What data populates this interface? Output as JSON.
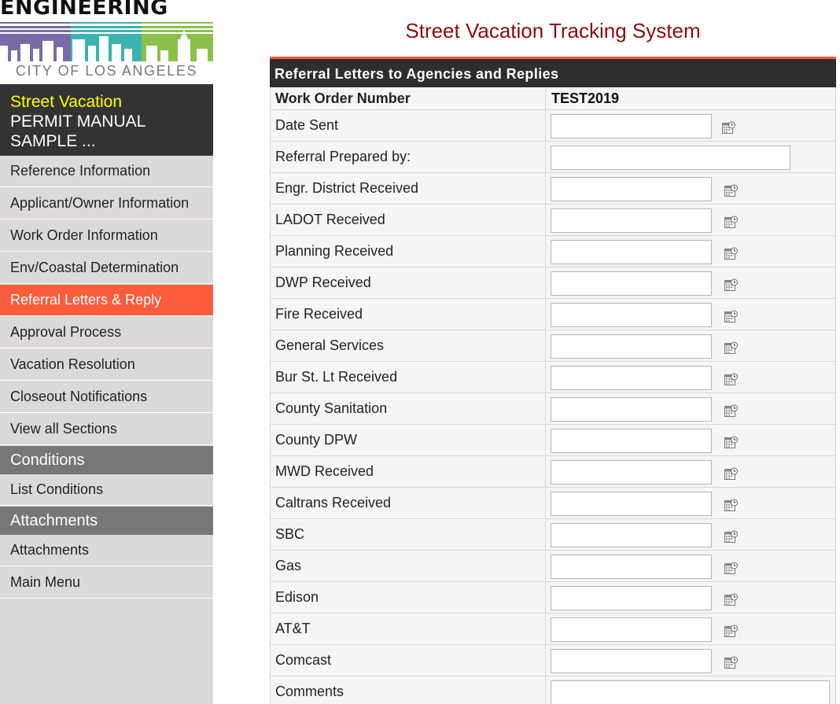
{
  "logo": {
    "word": "ENGINEERING",
    "city": "CITY OF LOS ANGELES"
  },
  "sidebar": {
    "title": "Street Vacation",
    "subtitle_line1": "PERMIT MANUAL",
    "subtitle_line2": "SAMPLE ...",
    "items": [
      {
        "label": "Reference Information"
      },
      {
        "label": "Applicant/Owner Information"
      },
      {
        "label": "Work Order Information"
      },
      {
        "label": "Env/Coastal Determination"
      },
      {
        "label": "Referral Letters & Reply",
        "active": true
      },
      {
        "label": "Approval Process"
      },
      {
        "label": "Vacation Resolution"
      },
      {
        "label": "Closeout Notifications"
      },
      {
        "label": "View all Sections"
      }
    ],
    "conditions_header": "Conditions",
    "conditions_items": [
      {
        "label": "List Conditions"
      }
    ],
    "attachments_header": "Attachments",
    "attachments_items": [
      {
        "label": "Attachments"
      },
      {
        "label": "Main Menu"
      }
    ]
  },
  "main": {
    "title": "Street Vacation Tracking System",
    "section_header": "Referral Letters to Agencies and Replies",
    "work_order": {
      "label": "Work Order Number",
      "value": "TEST2019"
    },
    "rows": [
      {
        "label": "Date Sent",
        "value": ""
      },
      {
        "label": "Referral Prepared by:",
        "value": ""
      },
      {
        "label": "Engr. District Received",
        "value": ""
      },
      {
        "label": "LADOT Received",
        "value": ""
      },
      {
        "label": "Planning Received",
        "value": ""
      },
      {
        "label": "DWP Received",
        "value": ""
      },
      {
        "label": "Fire Received",
        "value": ""
      },
      {
        "label": "General Services",
        "value": ""
      },
      {
        "label": "Bur St. Lt Received",
        "value": ""
      },
      {
        "label": "County Sanitation",
        "value": ""
      },
      {
        "label": "County DPW",
        "value": ""
      },
      {
        "label": "MWD Received",
        "value": ""
      },
      {
        "label": "Caltrans Received",
        "value": ""
      },
      {
        "label": "SBC",
        "value": ""
      },
      {
        "label": "Gas",
        "value": ""
      },
      {
        "label": "Edison",
        "value": ""
      },
      {
        "label": "AT&T",
        "value": ""
      },
      {
        "label": "Comcast",
        "value": ""
      },
      {
        "label": "Comments",
        "value": ""
      }
    ]
  },
  "icons": {
    "calendar": "calendar-icon"
  },
  "colors": {
    "active_nav": "#fa5c3c",
    "title_red": "#8b0d0d",
    "title_yellow": "#ffff00",
    "header_dark": "#2e2e2e"
  }
}
